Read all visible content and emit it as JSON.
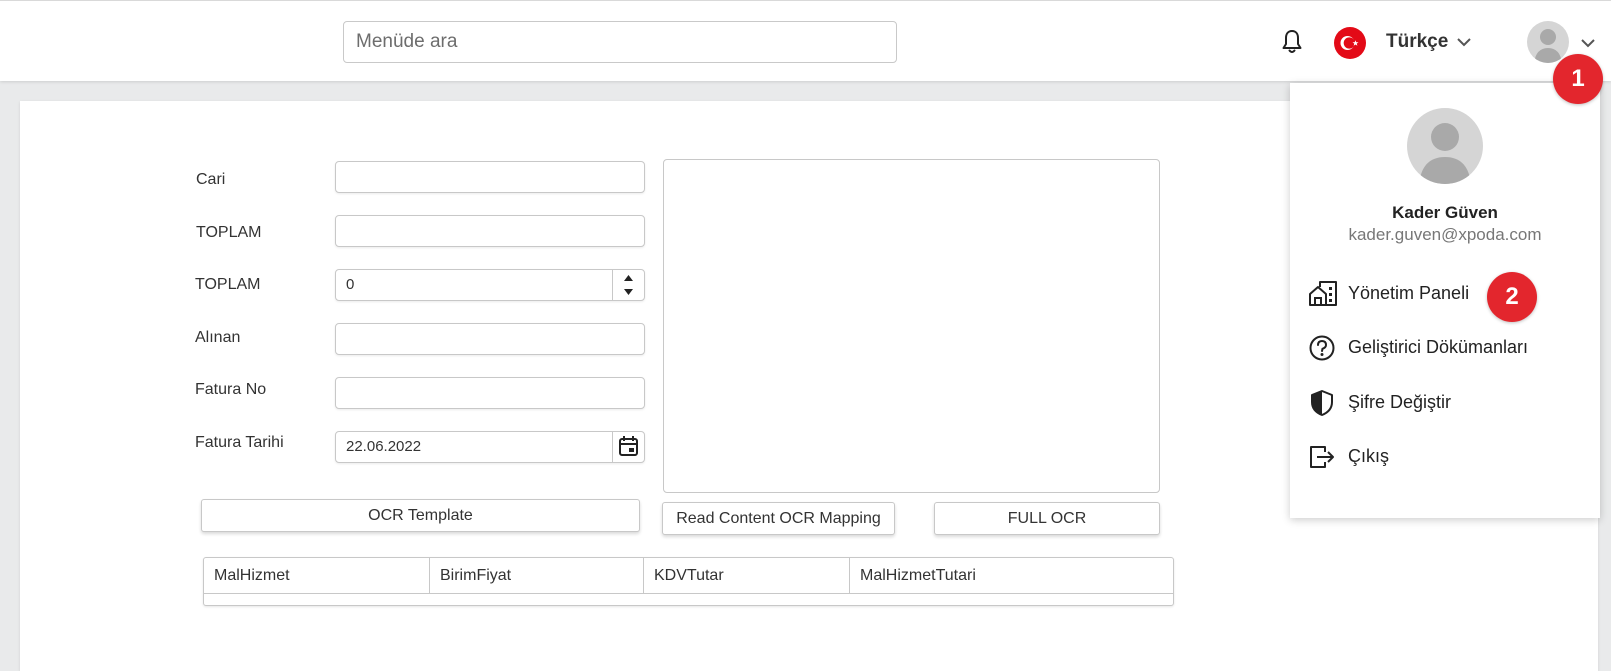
{
  "topbar": {
    "search_placeholder": "Menüde ara",
    "language": "Türkçe"
  },
  "form": {
    "labels": [
      "Cari",
      "TOPLAM",
      "TOPLAM",
      "Alınan",
      "Fatura No",
      "Fatura Tarihi"
    ],
    "toplam_number_value": "0",
    "fatura_tarihi_value": "22.06.2022"
  },
  "buttons": {
    "ocr_template": "OCR Template",
    "read_content": "Read Content OCR Mapping",
    "full_ocr": "FULL OCR"
  },
  "table": {
    "columns": [
      "MalHizmet",
      "BirimFiyat",
      "KDVTutar",
      "MalHizmetTutari"
    ]
  },
  "user_menu": {
    "name": "Kader Güven",
    "email": "kader.guven@xpoda.com",
    "items": [
      {
        "label": "Yönetim Paneli",
        "icon": "building-icon"
      },
      {
        "label": "Geliştirici Dökümanları",
        "icon": "help-circle-icon"
      },
      {
        "label": "Şifre Değiştir",
        "icon": "shield-icon"
      },
      {
        "label": "Çıkış",
        "icon": "logout-icon"
      }
    ]
  },
  "annotations": {
    "badge1": "1",
    "badge2": "2"
  },
  "colors": {
    "badge": "#e3262d",
    "flag": "#e30a17"
  }
}
